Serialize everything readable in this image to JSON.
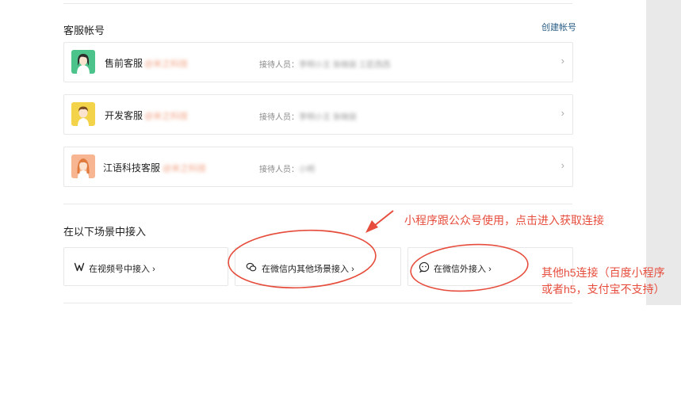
{
  "accounts_section": {
    "title": "客服帐号",
    "create_link": "创建帐号",
    "accounts": [
      {
        "name": "售前客服",
        "handle": "@米之科技",
        "staff_label": "接待人员：",
        "staff_value": "李明小王 张晓丽 工匠西西",
        "avatar": "green"
      },
      {
        "name": "开发客服",
        "handle": "@米之科技",
        "staff_label": "接待人员：",
        "staff_value": "李明小王 张晓丽",
        "avatar": "yellow"
      },
      {
        "name": "江语科技客服",
        "handle": "@米之科技",
        "staff_label": "接待人员：",
        "staff_value": "小明",
        "avatar": "peach"
      }
    ]
  },
  "scene_section": {
    "title": "在以下场景中接入",
    "options": [
      {
        "label": "在视频号中接入",
        "chevron": "›",
        "icon": "video-channel-icon"
      },
      {
        "label": "在微信内其他场景接入",
        "chevron": "›",
        "icon": "wechat-icon"
      },
      {
        "label": "在微信外接入",
        "chevron": "›",
        "icon": "chat-bubble-icon"
      }
    ]
  },
  "annotations": {
    "note_top": "小程序跟公众号使用，点击进入获取连接",
    "note_right_line1": "其他h5连接（百度小程序",
    "note_right_line2": "或者h5，支付宝不支持）",
    "color": "#e64d3d"
  }
}
